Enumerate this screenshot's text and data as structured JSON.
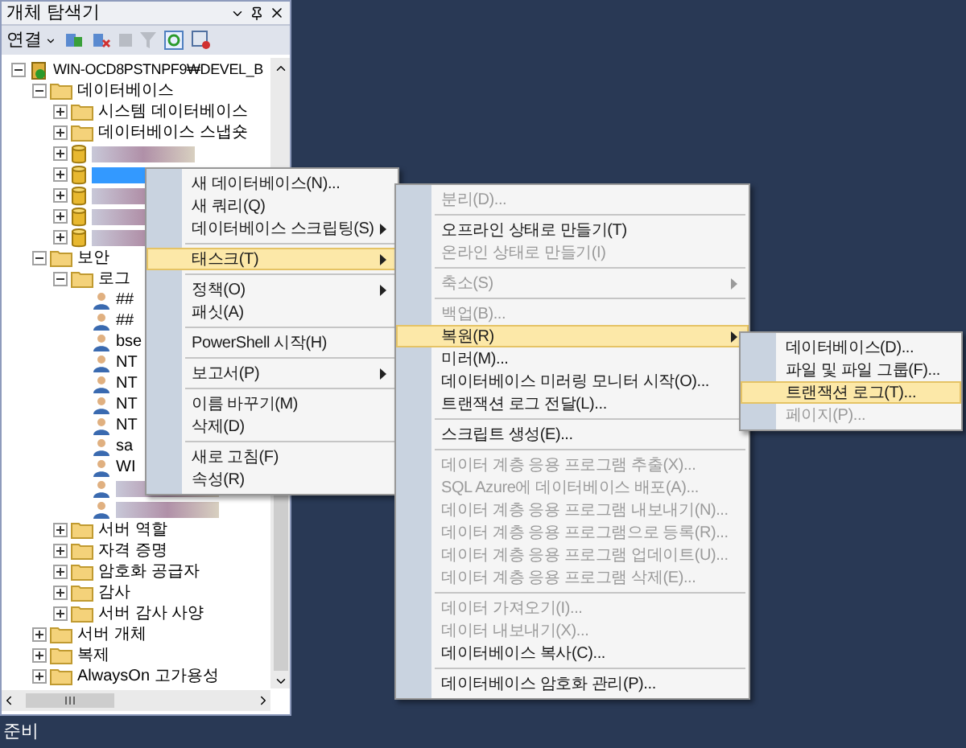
{
  "panel": {
    "title": "개체 탐색기",
    "connect_label": "연결"
  },
  "tree": [
    {
      "kind": "server",
      "label": "WIN-OCD8PSTNPF9₩DEVEL_B",
      "expanded": true,
      "children": [
        {
          "kind": "folder",
          "label": "데이터베이스",
          "expanded": true,
          "children": [
            {
              "kind": "folder",
              "label": "시스템 데이터베이스",
              "expanded": false
            },
            {
              "kind": "folder",
              "label": "데이터베이스 스냅숏",
              "expanded": false
            },
            {
              "kind": "redacted-database",
              "expanded": false,
              "selected": false
            },
            {
              "kind": "redacted-database",
              "expanded": false,
              "selected": true
            },
            {
              "kind": "redacted-database",
              "expanded": false,
              "selected": false
            },
            {
              "kind": "redacted-database",
              "expanded": false,
              "selected": false
            },
            {
              "kind": "redacted-database",
              "expanded": false,
              "selected": false
            }
          ]
        },
        {
          "kind": "folder",
          "label": "보안",
          "expanded": true,
          "children": [
            {
              "kind": "folder",
              "label": "로그",
              "expanded": true,
              "children": [
                {
                  "kind": "login",
                  "label": "##"
                },
                {
                  "kind": "login",
                  "label": "##"
                },
                {
                  "kind": "login",
                  "label": "bse"
                },
                {
                  "kind": "login",
                  "label": "NT"
                },
                {
                  "kind": "login",
                  "label": "NT"
                },
                {
                  "kind": "login",
                  "label": "NT"
                },
                {
                  "kind": "login",
                  "label": "NT"
                },
                {
                  "kind": "login",
                  "label": "sa"
                },
                {
                  "kind": "login",
                  "label": "WI"
                },
                {
                  "kind": "redacted-login"
                },
                {
                  "kind": "redacted-login"
                }
              ]
            },
            {
              "kind": "folder",
              "label": "서버 역할",
              "expanded": false
            },
            {
              "kind": "folder",
              "label": "자격 증명",
              "expanded": false
            },
            {
              "kind": "folder",
              "label": "암호화 공급자",
              "expanded": false
            },
            {
              "kind": "folder",
              "label": "감사",
              "expanded": false
            },
            {
              "kind": "folder",
              "label": "서버 감사 사양",
              "expanded": false
            }
          ]
        },
        {
          "kind": "folder",
          "label": "서버 개체",
          "expanded": false
        },
        {
          "kind": "folder",
          "label": "복제",
          "expanded": false
        },
        {
          "kind": "folder",
          "label": "AlwaysOn 고가용성",
          "expanded": false
        }
      ]
    }
  ],
  "menus": [
    {
      "groups": [
        [
          {
            "label": "새 데이터베이스(N)...",
            "submenu": false,
            "disabled": false,
            "selected": false
          },
          {
            "label": "새 쿼리(Q)",
            "submenu": false,
            "disabled": false,
            "selected": false
          },
          {
            "label": "데이터베이스 스크립팅(S)",
            "submenu": true,
            "disabled": false,
            "selected": false
          }
        ],
        [
          {
            "label": "태스크(T)",
            "submenu": true,
            "disabled": false,
            "selected": true
          }
        ],
        [
          {
            "label": "정책(O)",
            "submenu": true,
            "disabled": false,
            "selected": false
          },
          {
            "label": "패싯(A)",
            "submenu": false,
            "disabled": false,
            "selected": false
          }
        ],
        [
          {
            "label": "PowerShell 시작(H)",
            "submenu": false,
            "disabled": false,
            "selected": false
          }
        ],
        [
          {
            "label": "보고서(P)",
            "submenu": true,
            "disabled": false,
            "selected": false
          }
        ],
        [
          {
            "label": "이름 바꾸기(M)",
            "submenu": false,
            "disabled": false,
            "selected": false
          },
          {
            "label": "삭제(D)",
            "submenu": false,
            "disabled": false,
            "selected": false
          }
        ],
        [
          {
            "label": "새로 고침(F)",
            "submenu": false,
            "disabled": false,
            "selected": false
          },
          {
            "label": "속성(R)",
            "submenu": false,
            "disabled": false,
            "selected": false
          }
        ]
      ]
    },
    {
      "groups": [
        [
          {
            "label": "분리(D)...",
            "submenu": false,
            "disabled": true,
            "selected": false
          }
        ],
        [
          {
            "label": "오프라인 상태로 만들기(T)",
            "submenu": false,
            "disabled": false,
            "selected": false
          },
          {
            "label": "온라인 상태로 만들기(I)",
            "submenu": false,
            "disabled": true,
            "selected": false
          }
        ],
        [
          {
            "label": "축소(S)",
            "submenu": true,
            "disabled": true,
            "selected": false
          }
        ],
        [
          {
            "label": "백업(B)...",
            "submenu": false,
            "disabled": true,
            "selected": false
          },
          {
            "label": "복원(R)",
            "submenu": true,
            "disabled": false,
            "selected": true
          },
          {
            "label": "미러(M)...",
            "submenu": false,
            "disabled": false,
            "selected": false
          },
          {
            "label": "데이터베이스 미러링 모니터 시작(O)...",
            "submenu": false,
            "disabled": false,
            "selected": false
          },
          {
            "label": "트랜잭션 로그 전달(L)...",
            "submenu": false,
            "disabled": false,
            "selected": false
          }
        ],
        [
          {
            "label": "스크립트 생성(E)...",
            "submenu": false,
            "disabled": false,
            "selected": false
          }
        ],
        [
          {
            "label": "데이터 계층 응용 프로그램 추출(X)...",
            "submenu": false,
            "disabled": true,
            "selected": false
          },
          {
            "label": "SQL Azure에 데이터베이스 배포(A)...",
            "submenu": false,
            "disabled": true,
            "selected": false
          },
          {
            "label": "데이터 계층 응용 프로그램 내보내기(N)...",
            "submenu": false,
            "disabled": true,
            "selected": false
          },
          {
            "label": "데이터 계층 응용 프로그램으로 등록(R)...",
            "submenu": false,
            "disabled": true,
            "selected": false
          },
          {
            "label": "데이터 계층 응용 프로그램 업데이트(U)...",
            "submenu": false,
            "disabled": true,
            "selected": false
          },
          {
            "label": "데이터 계층 응용 프로그램 삭제(E)...",
            "submenu": false,
            "disabled": true,
            "selected": false
          }
        ],
        [
          {
            "label": "데이터 가져오기(I)...",
            "submenu": false,
            "disabled": true,
            "selected": false
          },
          {
            "label": "데이터 내보내기(X)...",
            "submenu": false,
            "disabled": true,
            "selected": false
          },
          {
            "label": "데이터베이스 복사(C)...",
            "submenu": false,
            "disabled": false,
            "selected": false
          }
        ],
        [
          {
            "label": "데이터베이스 암호화 관리(P)...",
            "submenu": false,
            "disabled": false,
            "selected": false
          }
        ]
      ]
    },
    {
      "groups": [
        [
          {
            "label": "데이터베이스(D)...",
            "submenu": false,
            "disabled": false,
            "selected": false
          },
          {
            "label": "파일 및 파일 그룹(F)...",
            "submenu": false,
            "disabled": false,
            "selected": false
          },
          {
            "label": "트랜잭션 로그(T)...",
            "submenu": false,
            "disabled": false,
            "selected": true
          },
          {
            "label": "페이지(P)...",
            "submenu": false,
            "disabled": true,
            "selected": false
          }
        ]
      ]
    }
  ],
  "status_bar": {
    "text": "준비"
  }
}
